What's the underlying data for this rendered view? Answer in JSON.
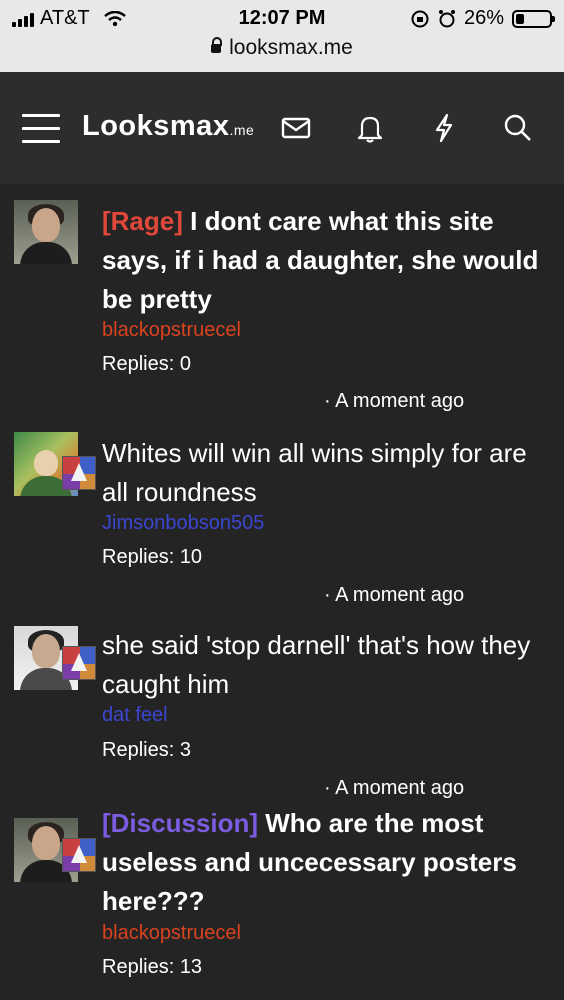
{
  "status_bar": {
    "carrier": "AT&T",
    "time": "12:07 PM",
    "battery": "26%",
    "battery_level": 0.26
  },
  "browser": {
    "url": "looksmax.me"
  },
  "header": {
    "logo_main": "Looksmax",
    "logo_suffix": ".me",
    "icons": [
      "menu-icon",
      "mail-icon",
      "bell-icon",
      "lightning-icon",
      "search-icon"
    ]
  },
  "threads": [
    {
      "prefix": "[Rage]",
      "prefix_color": "#e0493a",
      "title": " I dont care what this site says, if i had a daughter, she would be pretty",
      "title_bold": true,
      "author": "blackopstruecel",
      "author_color": "#d9431f",
      "replies": "Replies: 0",
      "time": "· A moment ago"
    },
    {
      "prefix": "",
      "title": "Whites will win all wins simply for are all roundness",
      "title_bold": false,
      "author": "Jimsonbobson505",
      "author_color": "#3b46d1",
      "replies": "Replies: 10",
      "time": "· A moment ago"
    },
    {
      "prefix": "",
      "title": "she said 'stop darnell' that's how they caught him",
      "title_bold": false,
      "author": "dat feel",
      "author_color": "#3b46d1",
      "replies": "Replies: 3",
      "time": "· A moment ago"
    },
    {
      "prefix": "[Discussion]",
      "prefix_color": "#7b5ce0",
      "title": " Who are the most useless and uncecessary posters here???",
      "title_bold": true,
      "author": "blackopstruecel",
      "author_color": "#d9431f",
      "replies": "Replies: 13",
      "time": ""
    }
  ]
}
